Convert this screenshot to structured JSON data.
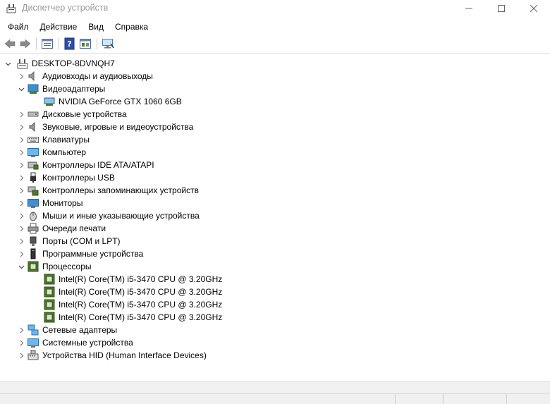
{
  "window": {
    "title": "Диспетчер устройств",
    "controls": {
      "minimize": "—",
      "maximize": "☐",
      "close": "✕"
    }
  },
  "menu": [
    "Файл",
    "Действие",
    "Вид",
    "Справка"
  ],
  "toolbar": [
    "back-icon",
    "forward-icon",
    "properties-icon",
    "help-icon",
    "view-icon",
    "scan-hardware-icon"
  ],
  "tree": {
    "root": "DESKTOP-8DVNQH7",
    "items": [
      {
        "label": "Аудиовходы и аудиовыходы",
        "icon": "audio-io-icon",
        "expanded": false
      },
      {
        "label": "Видеоадаптеры",
        "icon": "display-adapter-icon",
        "expanded": true,
        "children": [
          "NVIDIA GeForce GTX 1060 6GB"
        ]
      },
      {
        "label": "Дисковые устройства",
        "icon": "disk-drive-icon",
        "expanded": false
      },
      {
        "label": "Звуковые, игровые и видеоустройства",
        "icon": "sound-icon",
        "expanded": false
      },
      {
        "label": "Клавиатуры",
        "icon": "keyboard-icon",
        "expanded": false
      },
      {
        "label": "Компьютер",
        "icon": "computer-icon",
        "expanded": false
      },
      {
        "label": "Контроллеры IDE ATA/ATAPI",
        "icon": "ide-controller-icon",
        "expanded": false
      },
      {
        "label": "Контроллеры USB",
        "icon": "usb-icon",
        "expanded": false
      },
      {
        "label": "Контроллеры запоминающих устройств",
        "icon": "storage-controller-icon",
        "expanded": false
      },
      {
        "label": "Мониторы",
        "icon": "monitor-icon",
        "expanded": false
      },
      {
        "label": "Мыши и иные указывающие устройства",
        "icon": "mouse-icon",
        "expanded": false
      },
      {
        "label": "Очереди печати",
        "icon": "printer-icon",
        "expanded": false
      },
      {
        "label": "Порты (COM и LPT)",
        "icon": "port-icon",
        "expanded": false
      },
      {
        "label": "Программные устройства",
        "icon": "software-device-icon",
        "expanded": false
      },
      {
        "label": "Процессоры",
        "icon": "processor-icon",
        "expanded": true,
        "children": [
          "Intel(R) Core(TM) i5-3470 CPU @ 3.20GHz",
          "Intel(R) Core(TM) i5-3470 CPU @ 3.20GHz",
          "Intel(R) Core(TM) i5-3470 CPU @ 3.20GHz",
          "Intel(R) Core(TM) i5-3470 CPU @ 3.20GHz"
        ]
      },
      {
        "label": "Сетевые адаптеры",
        "icon": "network-adapter-icon",
        "expanded": false
      },
      {
        "label": "Системные устройства",
        "icon": "system-device-icon",
        "expanded": false
      },
      {
        "label": "Устройства HID (Human Interface Devices)",
        "icon": "hid-icon",
        "expanded": false
      }
    ]
  },
  "colors": {
    "title_text": "#9a9a9a",
    "cpu_green": "#4e7a2c",
    "monitor_blue": "#3d8fd1"
  }
}
